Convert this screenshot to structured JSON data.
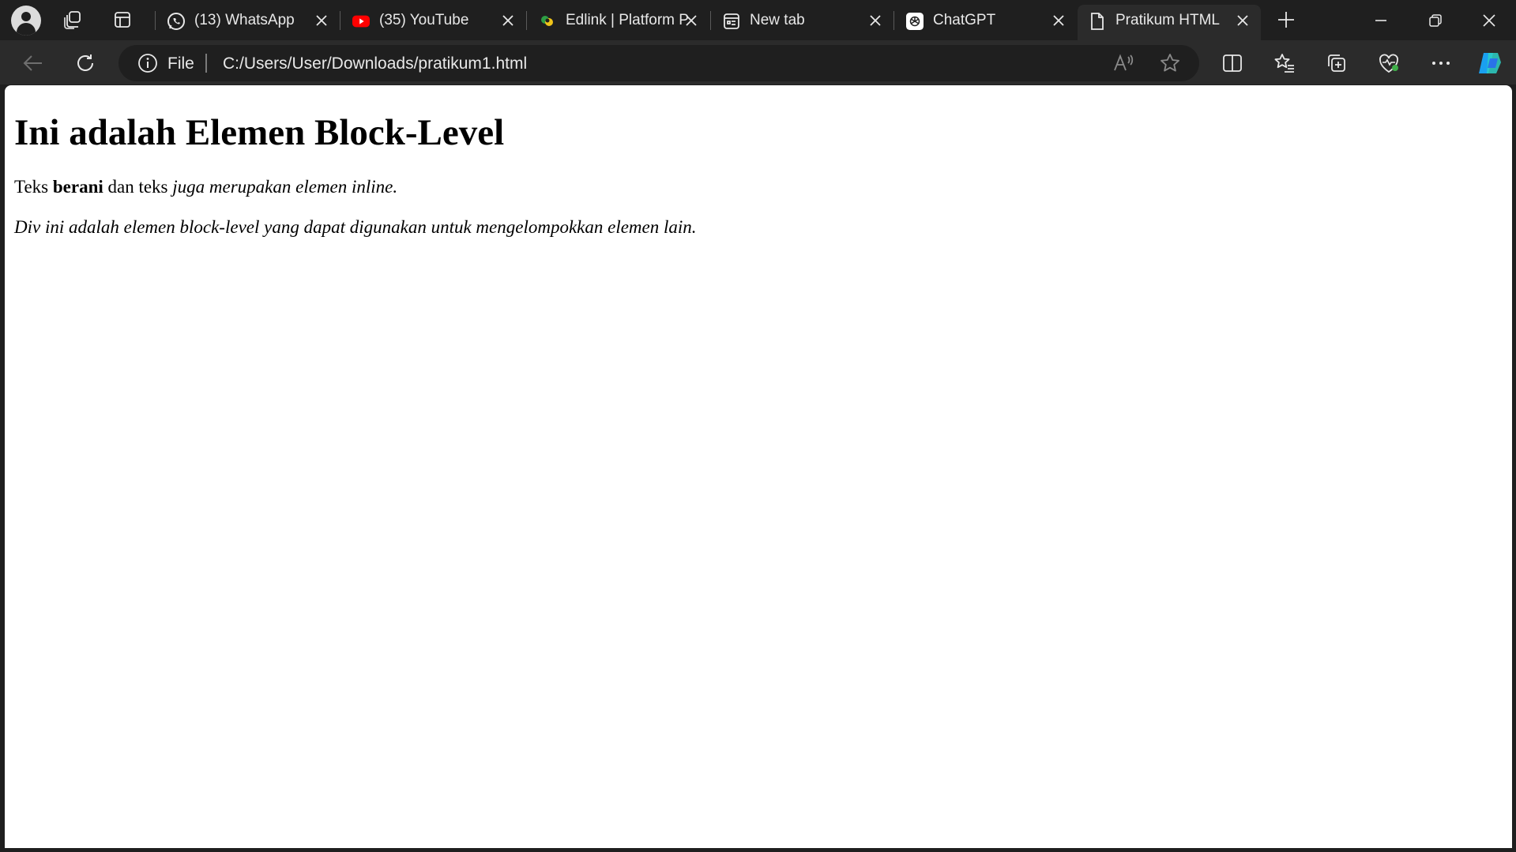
{
  "tabs": [
    {
      "title": "(13) WhatsApp",
      "icon": "whatsapp-icon"
    },
    {
      "title": "(35) YouTube",
      "icon": "youtube-icon"
    },
    {
      "title": "Edlink | Platform P",
      "icon": "edlink-icon"
    },
    {
      "title": "New tab",
      "icon": "new-tab-icon"
    },
    {
      "title": "ChatGPT",
      "icon": "chatgpt-icon"
    },
    {
      "title": "Pratikum HTML",
      "icon": "document-icon",
      "active": true
    }
  ],
  "address_bar": {
    "scheme_label": "File",
    "url": "C:/Users/User/Downloads/pratikum1.html"
  },
  "page": {
    "heading": "Ini adalah Elemen Block-Level",
    "paragraph1": {
      "text_before": "Teks ",
      "bold_text": "berani",
      "text_middle": " dan teks ",
      "italic_text": "juga merupakan elemen inline."
    },
    "paragraph2": "Div ini adalah elemen block-level yang dapat digunakan untuk mengelompokkan elemen lain."
  },
  "colors": {
    "tabstrip_bg": "#1f1f1f",
    "toolbar_bg": "#2b2b2b",
    "text_light": "#e8e8e8",
    "page_bg": "#ffffff",
    "whatsapp_green": "#25d366",
    "youtube_red": "#ff0000"
  }
}
